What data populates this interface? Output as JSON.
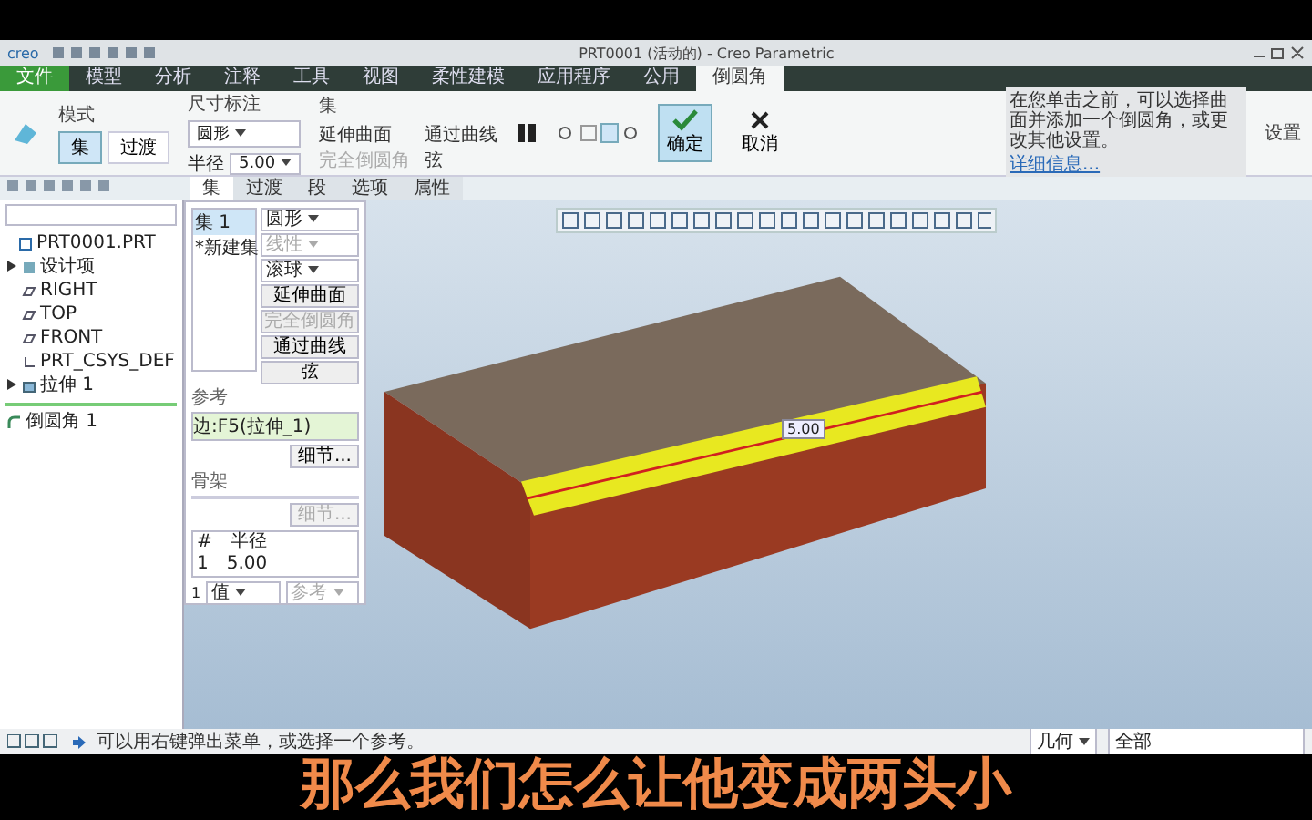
{
  "window": {
    "logo": "creo",
    "title": "PRT0001 (活动的) - Creo Parametric"
  },
  "ribbon_tabs": [
    {
      "label": "文件",
      "kind": "file",
      "selected": false
    },
    {
      "label": "模型",
      "kind": "tab",
      "selected": false
    },
    {
      "label": "分析",
      "kind": "tab",
      "selected": false
    },
    {
      "label": "注释",
      "kind": "tab",
      "selected": false
    },
    {
      "label": "工具",
      "kind": "tab",
      "selected": false
    },
    {
      "label": "视图",
      "kind": "tab",
      "selected": false
    },
    {
      "label": "柔性建模",
      "kind": "tab",
      "selected": false
    },
    {
      "label": "应用程序",
      "kind": "tab",
      "selected": false
    },
    {
      "label": "公用",
      "kind": "tab",
      "selected": false
    },
    {
      "label": "倒圆角",
      "kind": "tab",
      "selected": true
    }
  ],
  "ribbon": {
    "mode_group": {
      "label": "模式",
      "options": [
        {
          "label": "集",
          "selected": true
        },
        {
          "label": "过渡",
          "selected": false
        }
      ]
    },
    "dimension_group": {
      "label": "尺寸标注",
      "shape": "圆形",
      "radius_label": "半径",
      "radius": "5.00"
    },
    "set_group": {
      "label": "集",
      "items": [
        {
          "label": "延伸曲面",
          "disabled": false
        },
        {
          "label": "通过曲线",
          "disabled": false
        },
        {
          "label": "完全倒圆角",
          "disabled": true
        },
        {
          "label": "弦",
          "disabled": false
        }
      ]
    },
    "confirm": "确定",
    "cancel": "取消",
    "hint": {
      "text": "在您单击之前，可以选择曲面并添加一个倒圆角，或更改其他设置。",
      "link": "详细信息..."
    },
    "side_label": "设置"
  },
  "sub_tabs": [
    {
      "label": "集",
      "selected": true
    },
    {
      "label": "过渡",
      "selected": false
    },
    {
      "label": "段",
      "selected": false
    },
    {
      "label": "选项",
      "selected": false
    },
    {
      "label": "属性",
      "selected": false
    }
  ],
  "model_tree": {
    "items": [
      {
        "label": "PRT0001.PRT",
        "kind": "part",
        "collapsed": false,
        "children": [
          {
            "label": "设计项",
            "kind": "layers",
            "collapsed": true
          },
          {
            "label": "RIGHT",
            "kind": "plane",
            "collapsed": false
          },
          {
            "label": "TOP",
            "kind": "plane",
            "collapsed": false
          },
          {
            "label": "FRONT",
            "kind": "plane",
            "collapsed": false
          },
          {
            "label": "PRT_CSYS_DEF",
            "kind": "csys",
            "collapsed": false
          },
          {
            "label": "拉伸 1",
            "kind": "extrude",
            "collapsed": true
          }
        ]
      }
    ],
    "inserted": {
      "label": "倒圆角 1",
      "kind": "round"
    }
  },
  "set_panel": {
    "sets": [
      {
        "label": "集 1",
        "selected": true
      },
      {
        "label": "*新建集",
        "selected": false
      }
    ],
    "shape": "圆形",
    "method_disabled": "线性",
    "method": "滚球",
    "buttons": [
      {
        "label": "延伸曲面",
        "disabled": false
      },
      {
        "label": "完全倒圆角",
        "disabled": true
      },
      {
        "label": "通过曲线",
        "disabled": false
      },
      {
        "label": "弦",
        "disabled": false
      }
    ],
    "references_label": "参考",
    "reference": "边:F5(拉伸_1)",
    "details": "细节...",
    "bone_label": "骨架",
    "bone_details": "细节...",
    "radius_table": {
      "columns": [
        "#",
        "半径"
      ],
      "rows": [
        [
          "1",
          "5.00"
        ]
      ]
    },
    "footer_number": "1",
    "footer_left": "值",
    "footer_right": "参考"
  },
  "model_dimension": "5.00",
  "status": {
    "message": "可以用右键弹出菜单，或选择一个参考。",
    "filter": "几何",
    "selection": "全部"
  },
  "subtitle": "那么我们怎么让他变成两头小"
}
